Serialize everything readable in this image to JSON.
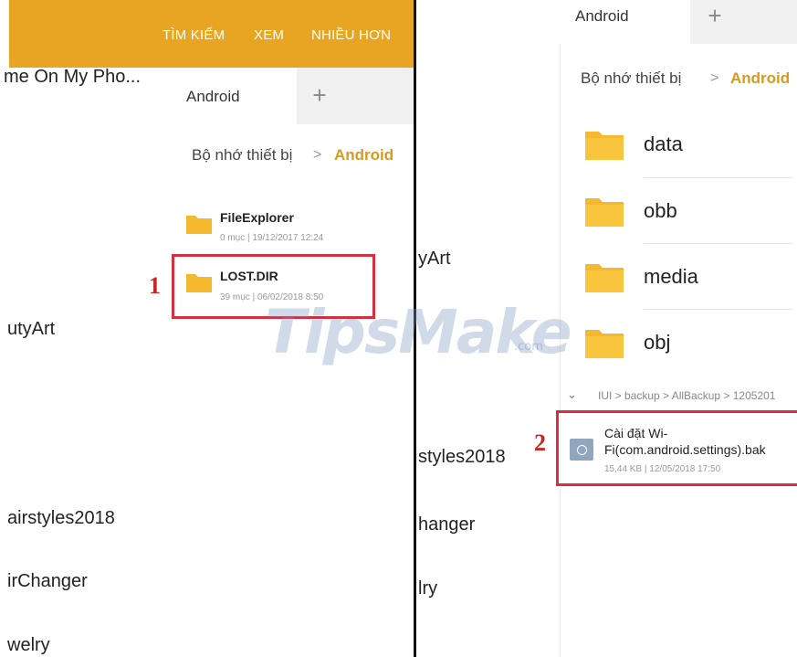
{
  "left": {
    "toolbar": {
      "search": "TÌM KIẾM",
      "view": "XEM",
      "more": "NHIỀU HƠN",
      "color": "#e8a522"
    },
    "background_list": [
      "me On My Pho...",
      "utyArt",
      "airstyles2018",
      "irChanger",
      "welry"
    ],
    "tabs": {
      "active": "Android",
      "add_icon": "plus-icon"
    },
    "breadcrumb": {
      "base": "Bộ nhớ thiết bị",
      "separator": ">",
      "current": "Android"
    },
    "items": [
      {
        "name": "FileExplorer",
        "meta": "0 mục | 19/12/2017 12:24",
        "icon": "folder-icon"
      },
      {
        "name": "LOST.DIR",
        "meta": "39 mục | 06/02/2018 8:50",
        "icon": "folder-icon"
      }
    ],
    "step_label": "1"
  },
  "right": {
    "background_list": [
      "yArt",
      "styles2018",
      "hanger",
      "lry"
    ],
    "tabs": {
      "active": "Android",
      "add_icon": "plus-icon"
    },
    "breadcrumb": {
      "base": "Bộ nhớ thiết bị",
      "separator": ">",
      "current": "Android"
    },
    "folders": [
      "data",
      "obb",
      "media",
      "obj"
    ],
    "path": "IUI > backup > AllBackup > 1205201",
    "file": {
      "name_line1": "Cài đặt Wi-",
      "name_line2": "Fi(com.android.settings).bak",
      "meta": "15,44 KB | 12/05/2018 17:50",
      "icon": "file-backup-icon"
    },
    "step_label": "2"
  },
  "watermark": {
    "text": "TipsMake",
    "domain": ".com"
  },
  "colors": {
    "accent": "#d99a1c",
    "folder": "#f5b82e",
    "highlight": "#d43040"
  }
}
